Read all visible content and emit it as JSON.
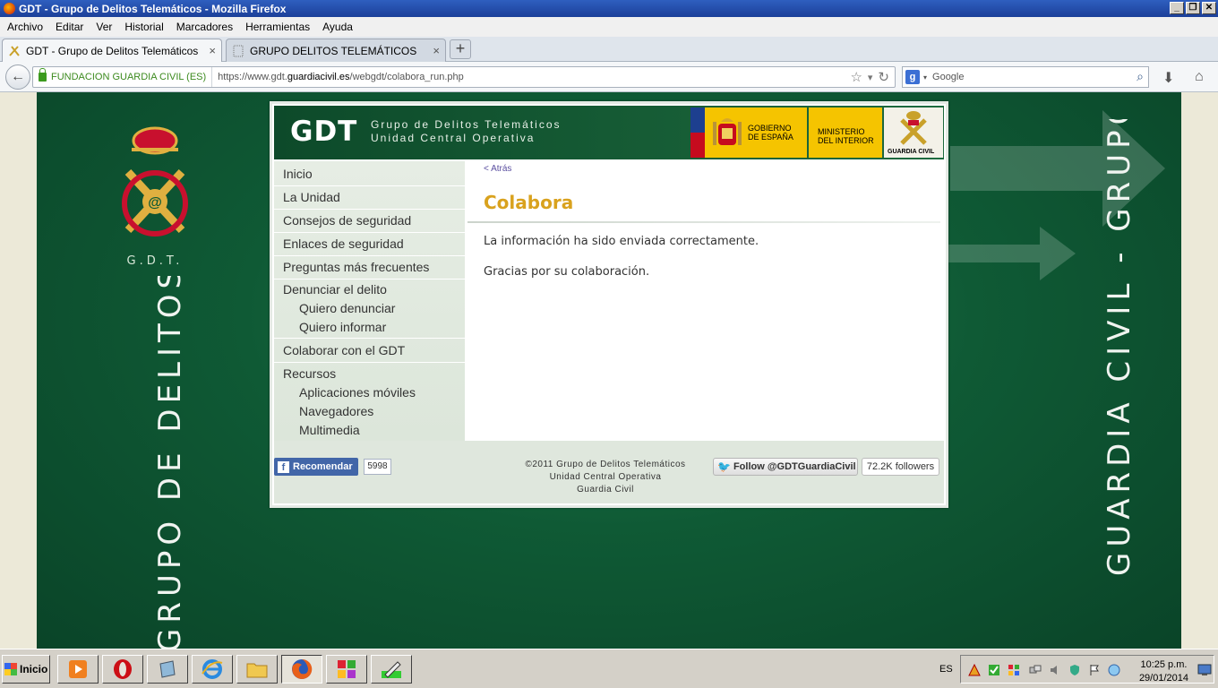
{
  "window": {
    "title": "GDT - Grupo de Delitos Telemáticos - Mozilla Firefox",
    "controls": [
      "_",
      "❐",
      "✕"
    ]
  },
  "menubar": [
    "Archivo",
    "Editar",
    "Ver",
    "Historial",
    "Marcadores",
    "Herramientas",
    "Ayuda"
  ],
  "tabs": [
    {
      "label": "GDT - Grupo de Delitos Telemáticos",
      "close": "×"
    },
    {
      "label": "GRUPO DELITOS TELEMÁTICOS",
      "close": "×"
    }
  ],
  "newtab": "+",
  "nav": {
    "identity": "FUNDACION GUARDIA CIVIL (ES)",
    "url_prefix": "https://www.gdt.",
    "url_domain": "guardiacivil.es",
    "url_path": "/webgdt/colabora_run.php",
    "search_placeholder": "Google"
  },
  "site": {
    "header": {
      "logo": "GDT",
      "subtitle_line1": "Grupo de Delitos Telemáticos",
      "subtitle_line2": "Unidad Central Operativa",
      "gob_line1": "GOBIERNO",
      "gob_line2": "DE ESPAÑA",
      "min_line1": "MINISTERIO",
      "min_line2": "DEL INTERIOR",
      "gc_label": "GUARDIA CIVIL"
    },
    "menu": {
      "inicio": "Inicio",
      "unidad": "La Unidad",
      "consejos": "Consejos de seguridad",
      "enlaces": "Enlaces de seguridad",
      "preguntas": "Preguntas más frecuentes",
      "denunciar": "Denunciar el delito",
      "quiero_denunciar": "Quiero denunciar",
      "quiero_informar": "Quiero informar",
      "colaborar": "Colaborar con el GDT",
      "recursos": "Recursos",
      "apps": "Aplicaciones móviles",
      "navegadores": "Navegadores",
      "multimedia": "Multimedia"
    },
    "content": {
      "back_link": "< Atrás",
      "title": "Colabora",
      "line1": "La información ha sido enviada correctamente.",
      "line2": "Gracias por su colaboración."
    },
    "footer": {
      "fb_label": "Recomendar",
      "fb_count": "5998",
      "copy_line1": "©2011 Grupo de Delitos Telemáticos",
      "copy_line2": "Unidad Central Operativa",
      "copy_line3": "Guardia Civil",
      "tw_label": "Follow @GDTGuardiaCivil",
      "tw_count": "72.2K followers"
    }
  },
  "background": {
    "left_emblem_label": "G.D.T.",
    "vertical_left": "GRUPO DE DELITOS TELEMÁTICOS - GUARDIA CIVIL",
    "vertical_right": "GUARDIA CIVIL - GRUPO DE DELITOS TELEMÁTICOS -"
  },
  "taskbar": {
    "start": "Inicio",
    "lang": "ES",
    "time": "10:25 p.m.",
    "date": "29/01/2014"
  },
  "colors": {
    "brand_green": "#0f5a35",
    "title_gold": "#d9a21e",
    "gov_yellow": "#f5c400"
  }
}
